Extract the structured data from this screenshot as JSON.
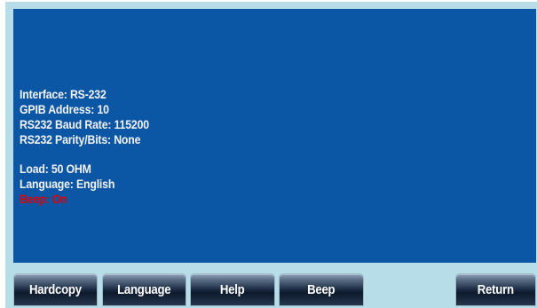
{
  "info": {
    "lines_group1": [
      "Interface: RS-232",
      "GPIB Address: 10",
      "RS232 Baud Rate: 115200",
      "RS232 Parity/Bits: None"
    ],
    "lines_group2": [
      "Load: 50 OHM",
      "Language: English"
    ],
    "highlight_line": "Beep: On"
  },
  "softkeys": {
    "hardcopy": "Hardcopy",
    "language": "Language",
    "help": "Help",
    "beep": "Beep",
    "return": "Return"
  },
  "colors": {
    "screen_bg": "#0b56a5",
    "frame_bg": "#b7dde8",
    "text": "#f2f2f2",
    "highlight": "#e00000"
  }
}
